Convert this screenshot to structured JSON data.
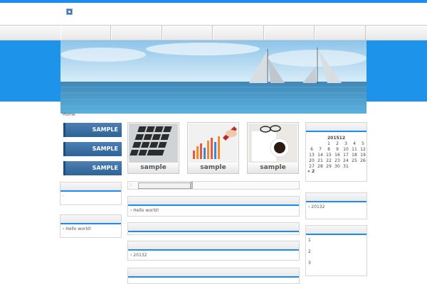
{
  "header": {
    "logo_icon": "site-logo-icon"
  },
  "nav": {
    "items": [
      "",
      "",
      "",
      "",
      "",
      ""
    ]
  },
  "breadcrumb": {
    "home": "Home"
  },
  "left": {
    "samples": [
      "SAMPLE",
      "SAMPLE",
      "SAMPLE"
    ],
    "widget1_text": "·",
    "widget2_text": "› Hello world!"
  },
  "center": {
    "thumbs": [
      {
        "caption": "sample",
        "icon": "keyboard-image"
      },
      {
        "caption": "sample",
        "icon": "chart-pen-image"
      },
      {
        "caption": "sample",
        "icon": "coffee-notebook-image"
      }
    ],
    "search_label": ":",
    "search_placeholder": "",
    "posts": [
      "› Hello world!",
      "› 20132"
    ]
  },
  "right": {
    "calendar": {
      "title": "201512",
      "rows": [
        [
          "",
          "",
          "1",
          "2",
          "3",
          "4",
          "5"
        ],
        [
          "6",
          "7",
          "8",
          "9",
          "10",
          "11",
          "12"
        ],
        [
          "13",
          "14",
          "15",
          "16",
          "17",
          "18",
          "19"
        ],
        [
          "20",
          "21",
          "22",
          "23",
          "24",
          "25",
          "26"
        ],
        [
          "27",
          "28",
          "29",
          "30",
          "31",
          "",
          ""
        ]
      ],
      "prev": "« 2"
    },
    "archive": "› 20132",
    "list": [
      "1",
      "2",
      "3"
    ]
  },
  "colors": {
    "accent": "#1a8ef0",
    "sample_blue": "#2d6398"
  }
}
